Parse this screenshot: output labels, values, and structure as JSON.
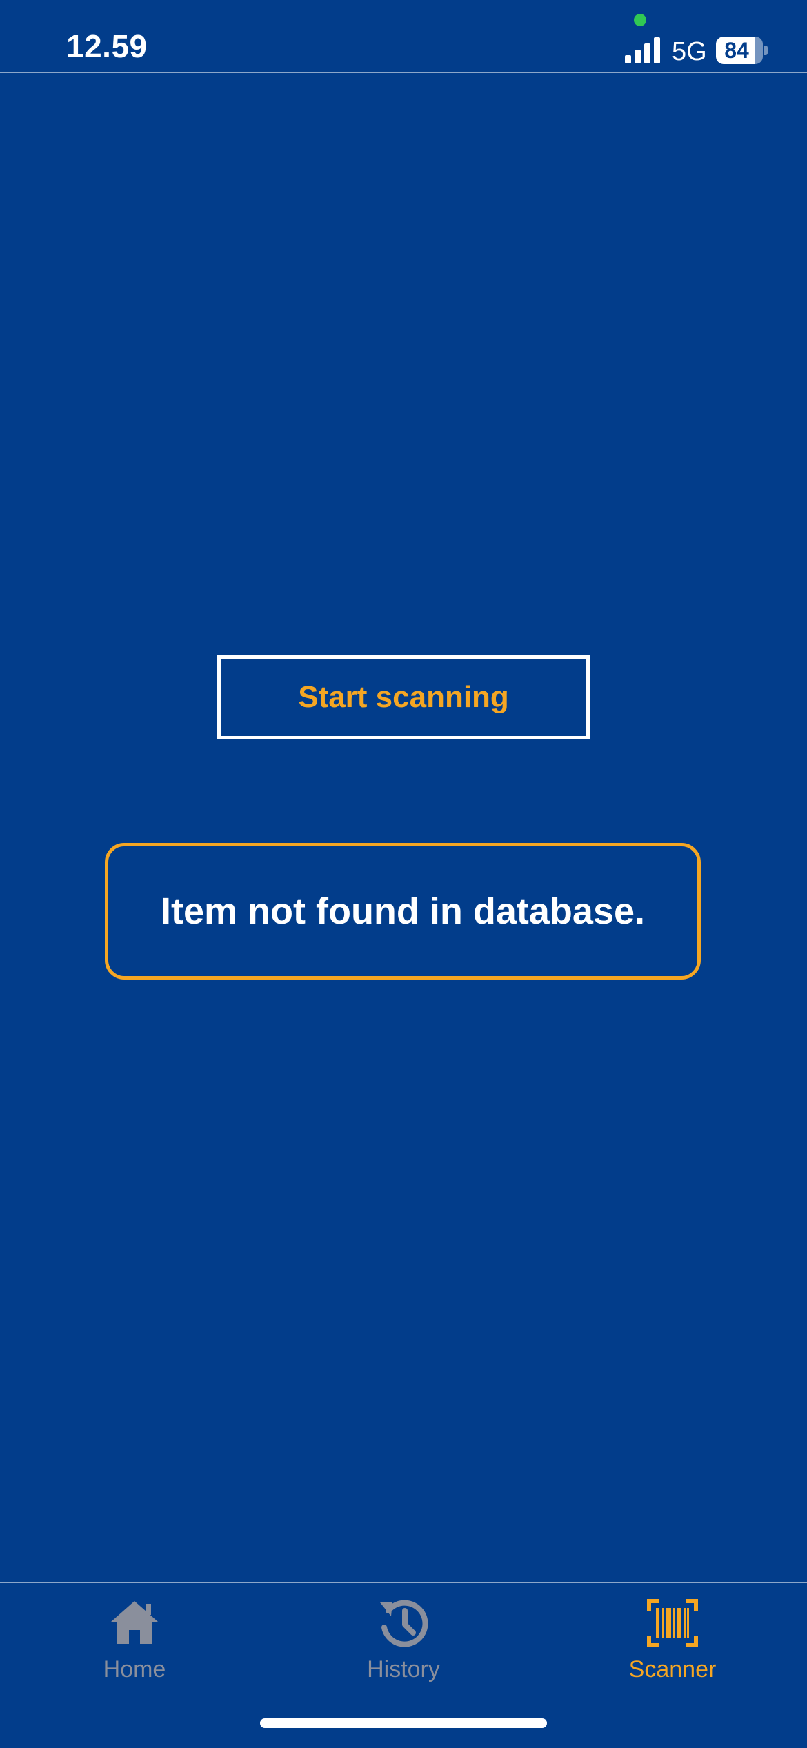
{
  "status_bar": {
    "time": "12.59",
    "network": "5G",
    "battery_level": "84",
    "battery_fraction": 0.84
  },
  "main": {
    "start_button_label": "Start scanning",
    "result_message": "Item not found in database."
  },
  "tab_bar": {
    "tabs": [
      {
        "label": "Home",
        "icon": "home-icon",
        "active": false
      },
      {
        "label": "History",
        "icon": "history-icon",
        "active": false
      },
      {
        "label": "Scanner",
        "icon": "barcode-scanner-icon",
        "active": true
      }
    ]
  },
  "colors": {
    "background": "#023D8B",
    "accent": "#F5A623",
    "inactive": "#8A8F9C",
    "text": "#FFFFFF",
    "privacy_dot": "#31C854"
  }
}
